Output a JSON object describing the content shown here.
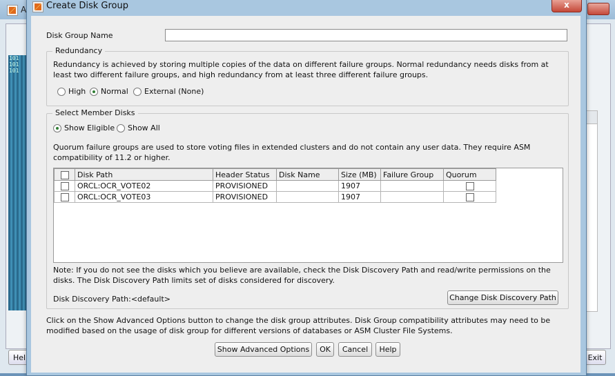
{
  "background": {
    "title": "A",
    "left_art_text": "101\n101\n101",
    "help_label": "Hel",
    "exit_label": "Exit"
  },
  "dialog": {
    "title": "Create Disk Group",
    "close_glyph": "x",
    "disk_group_name_label": "Disk Group Name",
    "disk_group_name_value": "",
    "redundancy": {
      "legend": "Redundancy",
      "description": "Redundancy is achieved by storing multiple copies of the data on different failure groups. Normal redundancy needs disks from at least two different failure groups, and high redundancy from at least three different failure groups.",
      "options": [
        "High",
        "Normal",
        "External (None)"
      ],
      "selected": "Normal"
    },
    "member_disks": {
      "legend": "Select Member Disks",
      "filter_options": [
        "Show Eligible",
        "Show All"
      ],
      "filter_selected": "Show Eligible",
      "quorum_note": "Quorum failure groups are used to store voting files in extended clusters and do not contain any user data. They require ASM compatibility of 11.2 or higher.",
      "columns": [
        "Disk Path",
        "Header Status",
        "Disk Name",
        "Size (MB)",
        "Failure Group",
        "Quorum"
      ],
      "rows": [
        {
          "path": "ORCL:OCR_VOTE02",
          "status": "PROVISIONED",
          "name": "",
          "size": "1907",
          "failure_group": ""
        },
        {
          "path": "ORCL:OCR_VOTE03",
          "status": "PROVISIONED",
          "name": "",
          "size": "1907",
          "failure_group": ""
        }
      ],
      "note": "Note: If you do not see the disks which you believe are available, check the Disk Discovery Path and read/write permissions on the disks. The Disk Discovery Path limits set of disks considered for discovery.",
      "discovery_path": "Disk Discovery Path:<default>",
      "change_path_label": "Change Disk Discovery Path"
    },
    "advanced_note": "Click on the Show Advanced Options button to change the disk group attributes. Disk Group compatibility attributes may need to be modified based on the usage of disk group for different versions of databases or ASM Cluster File Systems.",
    "buttons": {
      "advanced": "Show Advanced Options",
      "ok": "OK",
      "cancel": "Cancel",
      "help": "Help"
    }
  }
}
